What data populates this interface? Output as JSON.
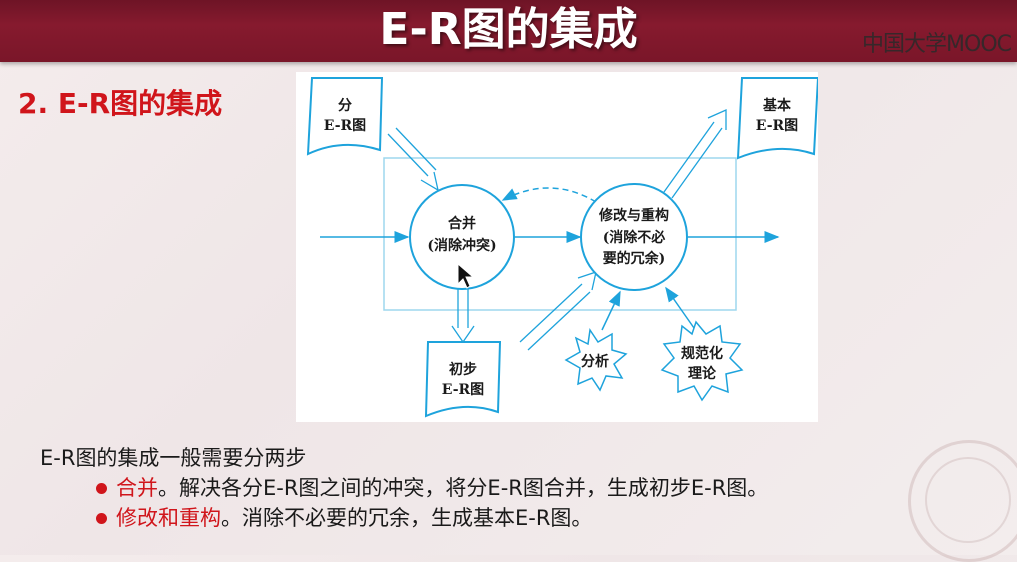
{
  "header": {
    "title": "E-R图的集成",
    "logo_text": "中国大学MOOC"
  },
  "section": {
    "title": "2. E-R图的集成"
  },
  "diagram": {
    "doc_top_left": {
      "line1": "分",
      "line2": "E-R图"
    },
    "doc_top_right": {
      "line1": "基本",
      "line2": "E-R图"
    },
    "doc_bottom": {
      "line1": "初步",
      "line2": "E-R图"
    },
    "circle_merge": {
      "line1": "合并",
      "line2": "(消除冲突)"
    },
    "circle_modify": {
      "line1": "修改与重构",
      "line2": "(消除不必",
      "line3": "要的冗余)"
    },
    "burst_analysis": {
      "line1": "分析"
    },
    "burst_normalize": {
      "line1": "规范化",
      "line2": "理论"
    },
    "colors": {
      "stroke": "#1ea3dc",
      "box": "#9ed7ee"
    }
  },
  "body": {
    "intro": "E-R图的集成一般需要分两步",
    "bullets": [
      {
        "term": "合并",
        "text": "。解决各分E-R图之间的冲突，将分E-R图合并，生成初步E-R图。"
      },
      {
        "term": "修改和重构",
        "text": "。消除不必要的冗余，生成基本E-R图。"
      }
    ]
  },
  "colors": {
    "title_bar": "#7a1629",
    "accent_red": "#d0151b"
  }
}
